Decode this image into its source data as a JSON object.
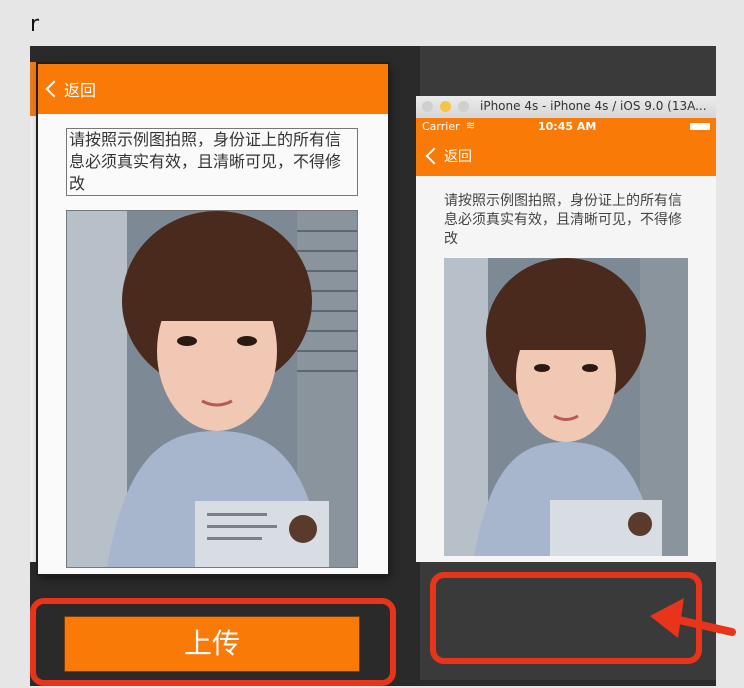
{
  "page_letter": "r",
  "left_phone": {
    "back_label": "返回",
    "instruction": "请按照示例图拍照，身份证上的所有信息必须真实有效，且清晰可见，不得修改",
    "upload_label": "上传"
  },
  "simulator": {
    "title": "iPhone 4s - iPhone 4s / iOS 9.0 (13A...",
    "carrier": "Carrier",
    "time": "10:45 AM",
    "back_label": "返回",
    "instruction": "请按照示例图拍照，身份证上的所有信息必须真实有效，且清晰可见，不得修改"
  },
  "colors": {
    "accent": "#f97a07",
    "highlight": "#e8341a"
  },
  "icons": [
    "back-chevron-icon",
    "wifi-icon",
    "battery-icon",
    "arrow-icon"
  ]
}
